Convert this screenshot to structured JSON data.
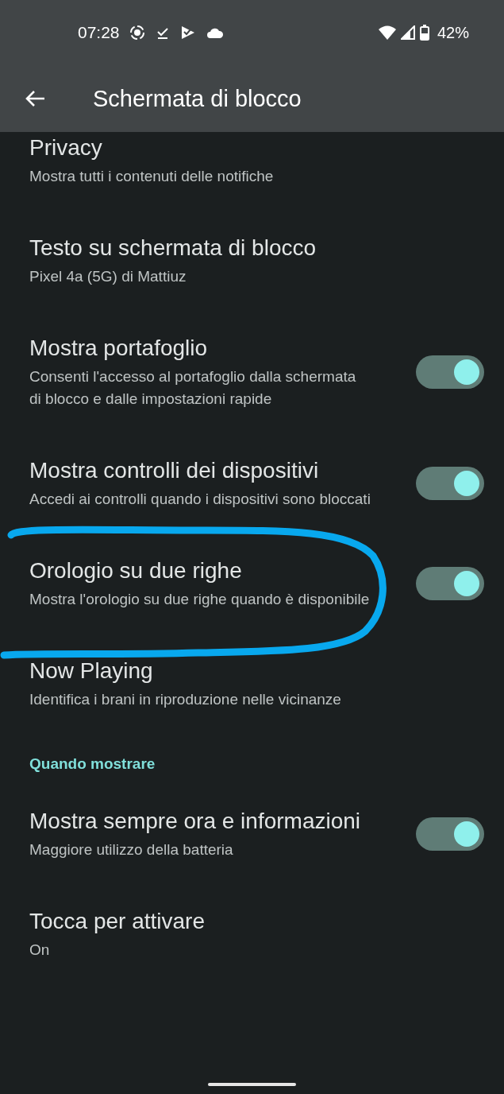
{
  "status_bar": {
    "time": "07:28",
    "battery": "42%"
  },
  "app_bar": {
    "title": "Schermata di blocco"
  },
  "items": [
    {
      "kind": "text",
      "title": "Privacy",
      "subtitle": "Mostra tutti i contenuti delle notifiche"
    },
    {
      "kind": "text",
      "title": "Testo su schermata di blocco",
      "subtitle": "Pixel 4a (5G) di Mattiuz"
    },
    {
      "kind": "switch",
      "title": "Mostra portafoglio",
      "subtitle": "Consenti l'accesso al portafoglio dalla schermata di blocco e dalle impostazioni rapide",
      "on": true
    },
    {
      "kind": "switch",
      "title": "Mostra controlli dei dispositivi",
      "subtitle": "Accedi ai controlli quando i dispositivi sono bloccati",
      "on": true
    },
    {
      "kind": "switch",
      "title": "Orologio su due righe",
      "subtitle": "Mostra l'orologio su due righe quando è disponibile",
      "on": true,
      "circled": true
    },
    {
      "kind": "text",
      "title": "Now Playing",
      "subtitle": "Identifica i brani in riproduzione nelle vicinanze"
    },
    {
      "kind": "header",
      "title": "Quando mostrare"
    },
    {
      "kind": "switch",
      "title": "Mostra sempre ora e informazioni",
      "subtitle": "Maggiore utilizzo della batteria",
      "on": true
    },
    {
      "kind": "text",
      "title": "Tocca per attivare",
      "subtitle": "On"
    }
  ]
}
